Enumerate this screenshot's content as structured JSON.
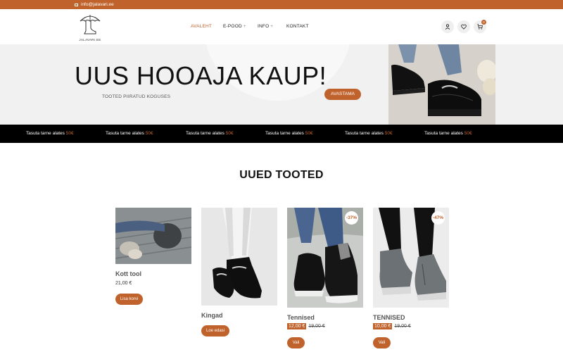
{
  "topbar": {
    "email": "info@jalavari.ee",
    "icon": "mail-icon"
  },
  "header": {
    "logo_text": "JALAVARI.EE",
    "nav": [
      {
        "label": "AVALEHT",
        "active": true
      },
      {
        "label": "E-POOD",
        "has_submenu": true,
        "submenu_glyph": "+"
      },
      {
        "label": "INFO",
        "has_submenu": true,
        "submenu_glyph": "+"
      },
      {
        "label": "KONTAKT"
      }
    ],
    "icons": [
      "user-icon",
      "heart-icon",
      "cart-icon"
    ],
    "cart_count": "0",
    "accent": "#c0622b"
  },
  "hero": {
    "title": "UUS HOOAJA KAUP!",
    "subtitle": "TOOTED PIIRATUD KOGUSES",
    "cta": "AVASTAMA"
  },
  "ticker": {
    "items": [
      {
        "text": "Tasuta tarne alates",
        "amount": "50€"
      },
      {
        "text": "Tasuta tarne alates",
        "amount": "50€"
      },
      {
        "text": "Tasuta tarne alates",
        "amount": "50€"
      },
      {
        "text": "Tasuta tarne alates",
        "amount": "50€"
      },
      {
        "text": "Tasuta tarne alates",
        "amount": "50€"
      },
      {
        "text": "Tasuta tarne alates",
        "amount": "50€"
      }
    ]
  },
  "section": {
    "title": "UUED TOOTED"
  },
  "products": [
    {
      "name": "Kott tool",
      "price": "21,00 €",
      "button": "Lisa korvi"
    },
    {
      "name": "Kingad",
      "button": "Loe edasi"
    },
    {
      "name": "Tennised",
      "sale_price": "12,00 €",
      "old_price": "19,00 €",
      "discount": "-37%",
      "button": "Vali"
    },
    {
      "name": "TENNISED",
      "sale_price": "10,00 €",
      "old_price": "19,00 €",
      "discount": "-47%",
      "button": "Vali"
    }
  ]
}
